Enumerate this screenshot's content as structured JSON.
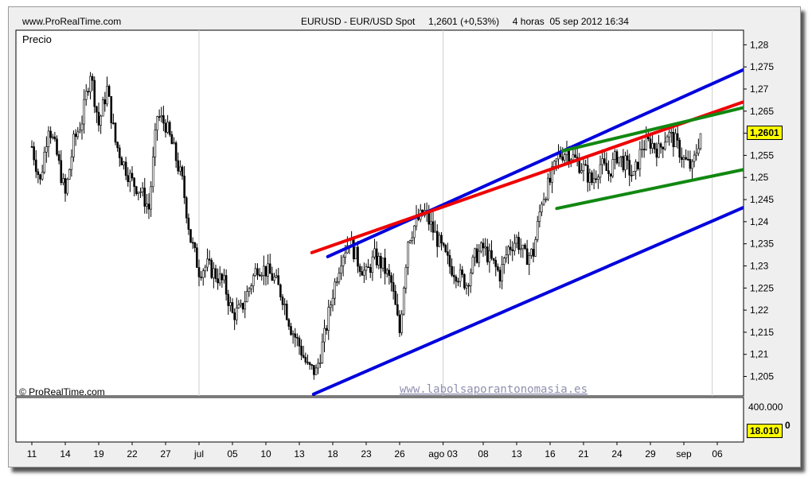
{
  "header": {
    "site": "www.ProRealTime.com",
    "title": "EURUSD - EUR/USD Spot     1,2601 (+0,53%)     4 horas  05 sep 2012 16:34"
  },
  "price_panel": {
    "label": "Precio",
    "copyright": "© ProRealTime.com",
    "watermark": "www.labolsaporantonomasia.es",
    "last_price_badge": "1,2601"
  },
  "volume_panel": {
    "top_label": "400.000",
    "badge": "18.010",
    "badge_suffix": "0"
  },
  "colors": {
    "channel": "#0000dd",
    "resistance": "#ee0000",
    "wedge": "#118811",
    "candle": "#000000",
    "badge_bg": "#ffff00",
    "watermark": "#9090b0"
  },
  "chart_data": {
    "type": "candlestick",
    "x_ticks": [
      "11",
      "14",
      "19",
      "22",
      "27",
      "jul",
      "05",
      "10",
      "13",
      "18",
      "23",
      "26",
      "ago 03",
      "08",
      "13",
      "16",
      "21",
      "24",
      "29",
      "sep",
      "06"
    ],
    "y_ticks": [
      "1,28",
      "1,275",
      "1,27",
      "1,265",
      "1,26",
      "1,255",
      "1,25",
      "1,245",
      "1,24",
      "1,235",
      "1,23",
      "1,225",
      "1,22",
      "1,215",
      "1,21",
      "1,205"
    ],
    "ylim": [
      1.2006,
      1.2833
    ],
    "last_price": 1.2601,
    "close_path": [
      [
        0,
        1.257
      ],
      [
        1,
        1.249
      ],
      [
        2,
        1.262
      ],
      [
        3,
        1.255
      ],
      [
        4,
        1.246
      ],
      [
        4.5,
        1.252
      ],
      [
        5,
        1.258
      ],
      [
        6,
        1.263
      ],
      [
        7,
        1.274
      ],
      [
        8,
        1.262
      ],
      [
        9,
        1.27
      ],
      [
        10,
        1.258
      ],
      [
        11,
        1.253
      ],
      [
        12,
        1.249
      ],
      [
        13,
        1.247
      ],
      [
        14,
        1.243
      ],
      [
        15,
        1.264
      ],
      [
        16,
        1.262
      ],
      [
        17,
        1.256
      ],
      [
        18,
        1.249
      ],
      [
        19,
        1.236
      ],
      [
        20,
        1.229
      ],
      [
        21,
        1.23
      ],
      [
        22,
        1.228
      ],
      [
        23,
        1.226
      ],
      [
        24,
        1.219
      ],
      [
        25,
        1.22
      ],
      [
        26,
        1.225
      ],
      [
        27,
        1.23
      ],
      [
        28,
        1.229
      ],
      [
        29,
        1.227
      ],
      [
        30,
        1.223
      ],
      [
        31,
        1.216
      ],
      [
        32,
        1.212
      ],
      [
        33,
        1.207
      ],
      [
        34,
        1.206
      ],
      [
        35,
        1.214
      ],
      [
        36,
        1.224
      ],
      [
        37,
        1.232
      ],
      [
        38,
        1.236
      ],
      [
        39,
        1.231
      ],
      [
        40,
        1.228
      ],
      [
        41,
        1.232
      ],
      [
        42,
        1.23
      ],
      [
        43,
        1.226
      ],
      [
        44,
        1.215
      ],
      [
        44.5,
        1.226
      ],
      [
        45,
        1.236
      ],
      [
        46,
        1.24
      ],
      [
        47,
        1.242
      ],
      [
        48,
        1.238
      ],
      [
        49,
        1.234
      ],
      [
        50,
        1.23
      ],
      [
        51,
        1.228
      ],
      [
        52,
        1.226
      ],
      [
        53,
        1.232
      ],
      [
        54,
        1.234
      ],
      [
        55,
        1.231
      ],
      [
        56,
        1.228
      ],
      [
        57,
        1.234
      ],
      [
        58,
        1.236
      ],
      [
        59,
        1.232
      ],
      [
        60,
        1.233
      ],
      [
        61,
        1.245
      ],
      [
        62,
        1.249
      ],
      [
        63,
        1.255
      ],
      [
        64,
        1.256
      ],
      [
        65,
        1.254
      ],
      [
        66,
        1.252
      ],
      [
        67,
        1.249
      ],
      [
        68,
        1.253
      ],
      [
        69,
        1.251
      ],
      [
        70,
        1.255
      ],
      [
        71,
        1.253
      ],
      [
        72,
        1.25
      ],
      [
        73,
        1.257
      ],
      [
        74,
        1.258
      ],
      [
        75,
        1.256
      ],
      [
        76,
        1.26
      ],
      [
        77,
        1.258
      ],
      [
        78,
        1.254
      ],
      [
        79,
        1.252
      ],
      [
        80,
        1.26
      ]
    ],
    "lines": [
      {
        "role": "channel-lower",
        "color": "blue",
        "from": [
          33.7,
          1.201
        ],
        "to": [
          90,
          1.2472
        ]
      },
      {
        "role": "channel-upper",
        "color": "blue",
        "from": [
          35.4,
          1.2321
        ],
        "to": [
          90,
          1.2785
        ]
      },
      {
        "role": "resistance",
        "color": "red",
        "from": [
          33.5,
          1.233
        ],
        "to": [
          90,
          1.2703
        ]
      },
      {
        "role": "wedge-upper",
        "color": "green",
        "from": [
          63.5,
          1.256
        ],
        "to": [
          90,
          1.268
        ]
      },
      {
        "role": "wedge-lower",
        "color": "green",
        "from": [
          62.8,
          1.243
        ],
        "to": [
          90,
          1.2537
        ]
      }
    ]
  }
}
